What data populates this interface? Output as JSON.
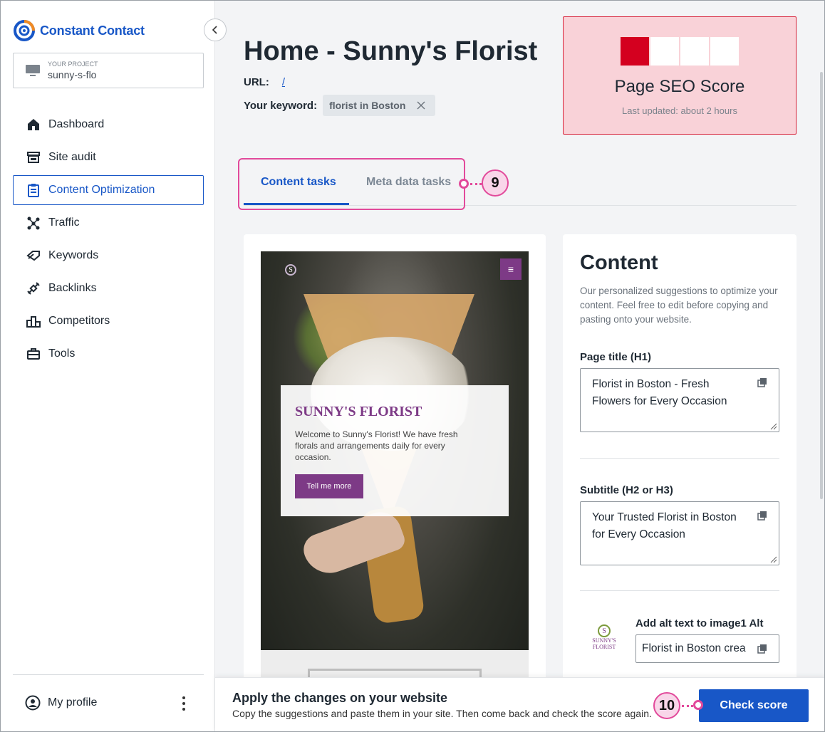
{
  "brand": {
    "name": "Constant Contact",
    "color": "#1857c7"
  },
  "project": {
    "label": "YOUR PROJECT",
    "name": "sunny-s-flo"
  },
  "sidebar": {
    "items": [
      {
        "label": "Dashboard",
        "icon": "home-icon"
      },
      {
        "label": "Site audit",
        "icon": "store-icon"
      },
      {
        "label": "Content Optimization",
        "icon": "clipboard-icon",
        "active": true
      },
      {
        "label": "Traffic",
        "icon": "network-icon"
      },
      {
        "label": "Keywords",
        "icon": "tag-icon"
      },
      {
        "label": "Backlinks",
        "icon": "link-icon"
      },
      {
        "label": "Competitors",
        "icon": "podium-icon"
      },
      {
        "label": "Tools",
        "icon": "toolbox-icon"
      }
    ],
    "profile_label": "My profile"
  },
  "page": {
    "title": "Home - Sunny's Florist",
    "url_label": "URL:",
    "url_value": "/",
    "keyword_label": "Your keyword:",
    "keyword_value": "florist in Boston"
  },
  "seo": {
    "title": "Page SEO Score",
    "updated": "Last updated: about 2 hours",
    "score_segments_filled": 1,
    "score_segments_total": 4,
    "accent": "#d4001f"
  },
  "tabs": [
    {
      "label": "Content tasks",
      "active": true
    },
    {
      "label": "Meta data tasks",
      "active": false
    }
  ],
  "callouts": {
    "tabs": "9",
    "check": "10"
  },
  "preview": {
    "brand": "SUNNY'S FLORIST",
    "text": "Welcome to Sunny's Florist! We have fresh florals and arrangements daily for every occasion.",
    "button": "Tell me more",
    "logo_letter": "S"
  },
  "content": {
    "title": "Content",
    "description": "Our personalized suggestions to optimize your content. Feel free to edit before copying and pasting onto your website.",
    "page_title_label": "Page title (H1)",
    "page_title_value": "Florist in Boston - Fresh Flowers for Every Occasion",
    "subtitle_label": "Subtitle (H2 or H3)",
    "subtitle_value": "Your Trusted Florist in Boston for Every Occasion",
    "alt_label": "Add alt text to image1 Alt",
    "alt_value": "Florist in Boston crea",
    "alt_logo_line1": "SUNNY'S",
    "alt_logo_line2": "FLORIST"
  },
  "bottom": {
    "title": "Apply the changes on your website",
    "subtitle": "Copy the suggestions and paste them in your site. Then come back and check the score again.",
    "button": "Check score"
  }
}
